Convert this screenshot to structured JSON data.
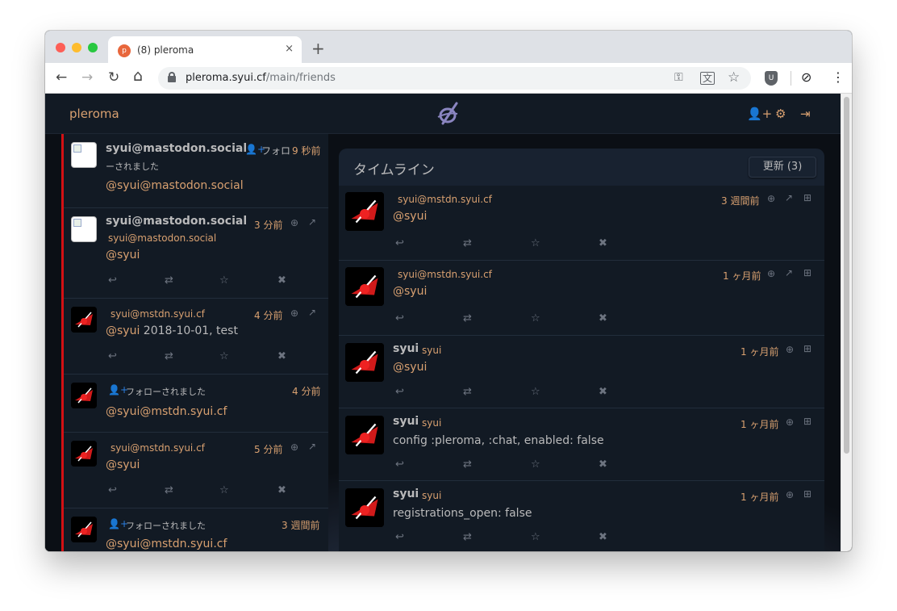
{
  "browser": {
    "tab_title": "(8) pleroma",
    "tab_close": "×",
    "new_tab": "+",
    "favicon_text": "p",
    "url_host": "pleroma.syui.cf",
    "url_path": "/main/friends",
    "nav": {
      "back": "←",
      "forward": "→",
      "reload": "↻",
      "home": "⌂"
    },
    "toolbar_icons": {
      "key": "⚿",
      "translate": "文",
      "star": "☆",
      "ublock": "U",
      "extension": "⊘",
      "menu": "⋮"
    }
  },
  "app": {
    "brand": "pleroma",
    "header_icons": {
      "add_user": "👤+",
      "settings": "⚙",
      "logout": "⇥"
    },
    "accent": "#d8a070",
    "bg": "#121a24"
  },
  "notifications": [
    {
      "name": "syui@mastodon.social",
      "action": "フォロ",
      "time": "9 秒前",
      "action_cont": "ーされました",
      "body": "@syui@mastodon.social"
    },
    {
      "name": "syui@mastodon.social",
      "time": "3 分前",
      "handle": "syui@mastodon.social",
      "body": "@syui"
    },
    {
      "handle": "syui@mstdn.syui.cf",
      "time": "4 分前",
      "mention": "@syui",
      "body": " 2018-10-01, test"
    },
    {
      "action": "フォローされました",
      "time": "4 分前",
      "body": "@syui@mstdn.syui.cf"
    },
    {
      "handle": "syui@mstdn.syui.cf",
      "time": "5 分前",
      "body": "@syui"
    },
    {
      "action": "フォローされました",
      "time": "3 週間前",
      "body": "@syui@mstdn.syui.cf"
    }
  ],
  "timeline": {
    "title": "タイムライン",
    "refresh": "更新 (3)",
    "posts": [
      {
        "handle": "syui@mstdn.syui.cf",
        "time": "3 週間前",
        "body": "@syui"
      },
      {
        "handle": "syui@mstdn.syui.cf",
        "time": "1 ヶ月前",
        "body": "@syui"
      },
      {
        "name": "syui",
        "handle": "syui",
        "time": "1 ヶ月前",
        "body": "@syui"
      },
      {
        "name": "syui",
        "handle": "syui",
        "time": "1 ヶ月前",
        "body": "config :pleroma, :chat, enabled: false"
      },
      {
        "name": "syui",
        "handle": "syui",
        "time": "1 ヶ月前",
        "body": "registrations_open: false"
      }
    ]
  },
  "actions": {
    "reply": "↩",
    "repeat": "⇄",
    "favorite": "☆",
    "delete": "✖"
  },
  "meta_icons": {
    "globe": "⊕",
    "external": "↗",
    "expand": "⊞"
  }
}
